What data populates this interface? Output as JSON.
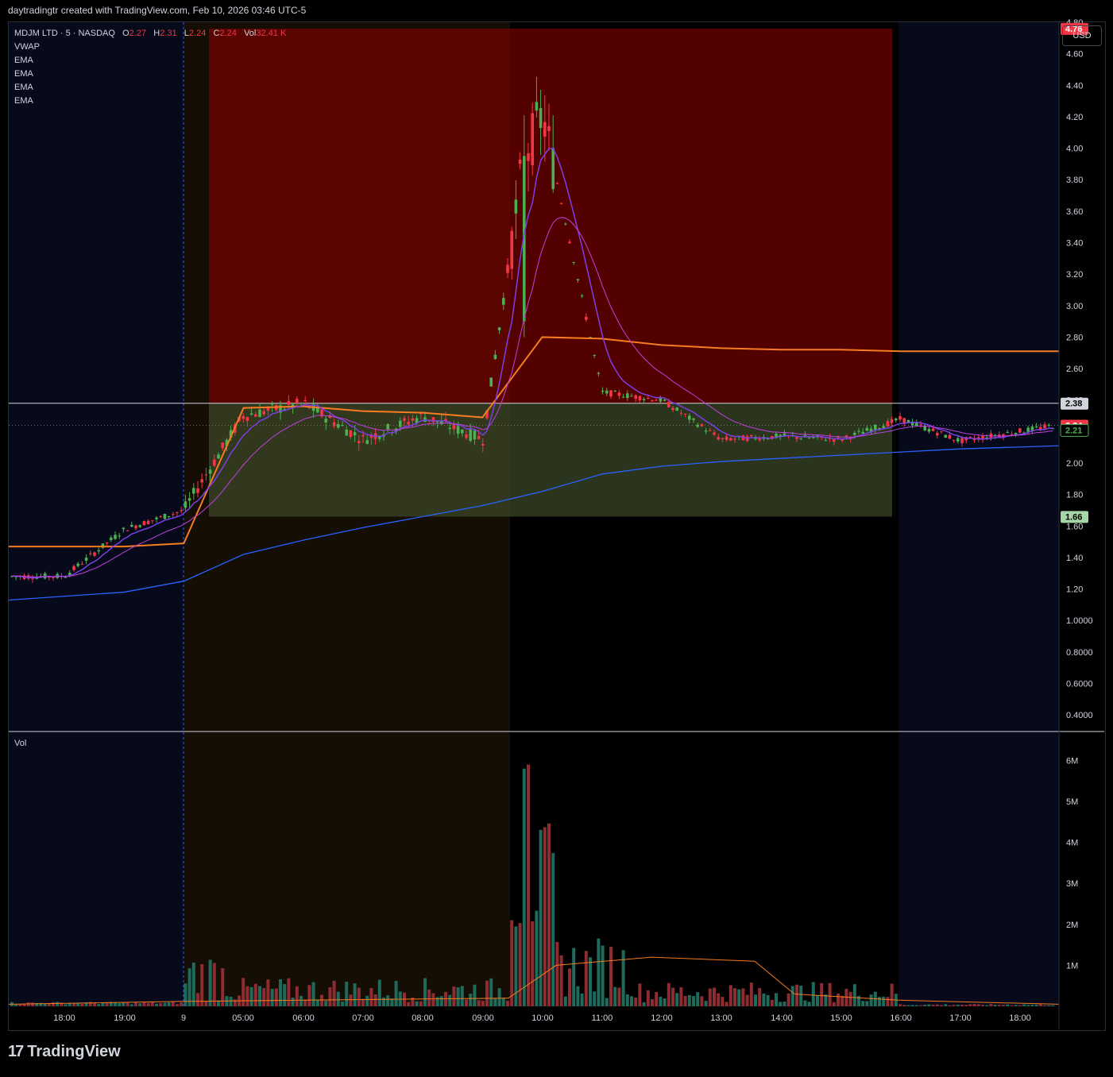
{
  "header": {
    "caption": "daytradingtr created with TradingView.com, Feb 10, 2026 03:46 UTC-5"
  },
  "legend": {
    "symbol": "MDJM LTD · 5 · NASDAQ",
    "o_label": "O",
    "o_value": "2.27",
    "h_label": "H",
    "h_value": "2.31",
    "l_label": "L",
    "l_value": "2.24",
    "c_label": "C",
    "c_value": "2.24",
    "vol_label": "Vol",
    "vol_value": "32.41 K",
    "indicators": [
      "VWAP",
      "EMA",
      "EMA",
      "EMA",
      "EMA"
    ]
  },
  "currency_button": "USD",
  "volume_pane_label": "Vol",
  "footer": {
    "brand": "TradingView",
    "logo_icon": "tradingview-logo-icon"
  },
  "colors": {
    "up": "#26a69a",
    "up_candle": "#4caf50",
    "down": "#f23645",
    "vwap": "#f57c20",
    "ema_fast": "#7b3fe4",
    "ema_slow": "#2962ff",
    "risk_zone": "#8b0000",
    "reward_zone": "#3d4a2a"
  },
  "chart_data": {
    "type": "candlestick",
    "title": "MDJM LTD · 5 · NASDAQ",
    "ylim": [
      0.3,
      4.8
    ],
    "y_ticks": [
      "4.80",
      "4.60",
      "4.40",
      "4.20",
      "4.00",
      "3.80",
      "3.60",
      "3.40",
      "3.20",
      "3.00",
      "2.80",
      "2.60",
      "2.40",
      "2.20",
      "2.00",
      "1.80",
      "1.60",
      "1.40",
      "1.20",
      "1.0000",
      "0.8000",
      "0.6000",
      "0.4000"
    ],
    "x_ticks": [
      "18:00",
      "19:00",
      "9",
      "05:00",
      "06:00",
      "07:00",
      "08:00",
      "09:00",
      "10:00",
      "11:00",
      "12:00",
      "13:00",
      "14:00",
      "15:00",
      "16:00",
      "17:00",
      "18:00"
    ],
    "price_labels": [
      {
        "value": "4.76",
        "kind": "stop"
      },
      {
        "value": "2.38",
        "kind": "entry"
      },
      {
        "value": "2.24",
        "kind": "last"
      },
      {
        "value": "2.21",
        "kind": "ema"
      },
      {
        "value": "1.66",
        "kind": "target"
      }
    ],
    "position": {
      "entry": 2.38,
      "stop": 4.76,
      "target": 1.66,
      "side": "short"
    },
    "sessions": [
      "pre-market",
      "regular",
      "post-market"
    ],
    "key_points": [
      {
        "time": "18:00",
        "price": 1.28
      },
      {
        "time": "19:00",
        "price": 1.58
      },
      {
        "time": "9",
        "price": 1.7
      },
      {
        "time": "05:00",
        "price": 2.3
      },
      {
        "time": "06:00",
        "price": 2.38
      },
      {
        "time": "07:00",
        "price": 2.15
      },
      {
        "time": "08:00",
        "price": 2.3
      },
      {
        "time": "09:00",
        "price": 2.15
      },
      {
        "time": "10:00",
        "price": 3.95
      },
      {
        "time": "10:00 high",
        "price": 4.21
      },
      {
        "time": "11:00",
        "price": 2.45
      },
      {
        "time": "12:00",
        "price": 2.4
      },
      {
        "time": "13:00",
        "price": 2.15
      },
      {
        "time": "14:00",
        "price": 2.17
      },
      {
        "time": "15:00",
        "price": 2.15
      },
      {
        "time": "16:00",
        "price": 2.28
      },
      {
        "time": "17:00",
        "price": 2.14
      },
      {
        "time": "18:00 end",
        "price": 2.24
      }
    ],
    "vwap_levels": [
      1.47,
      1.47,
      1.49,
      2.35,
      2.36,
      2.33,
      2.32,
      2.29,
      2.8,
      2.79,
      2.75,
      2.73,
      2.72,
      2.72,
      2.71,
      2.71,
      2.71
    ],
    "ema_slow_levels": [
      1.13,
      1.18,
      1.25,
      1.42,
      1.51,
      1.59,
      1.66,
      1.73,
      1.82,
      1.93,
      1.98,
      2.01,
      2.03,
      2.05,
      2.07,
      2.09,
      2.11
    ],
    "volume_ticks": [
      "6M",
      "5M",
      "4M",
      "3M",
      "2M",
      "1M"
    ],
    "volume_peak_time": "10:00",
    "volume_peak": 5.9
  }
}
